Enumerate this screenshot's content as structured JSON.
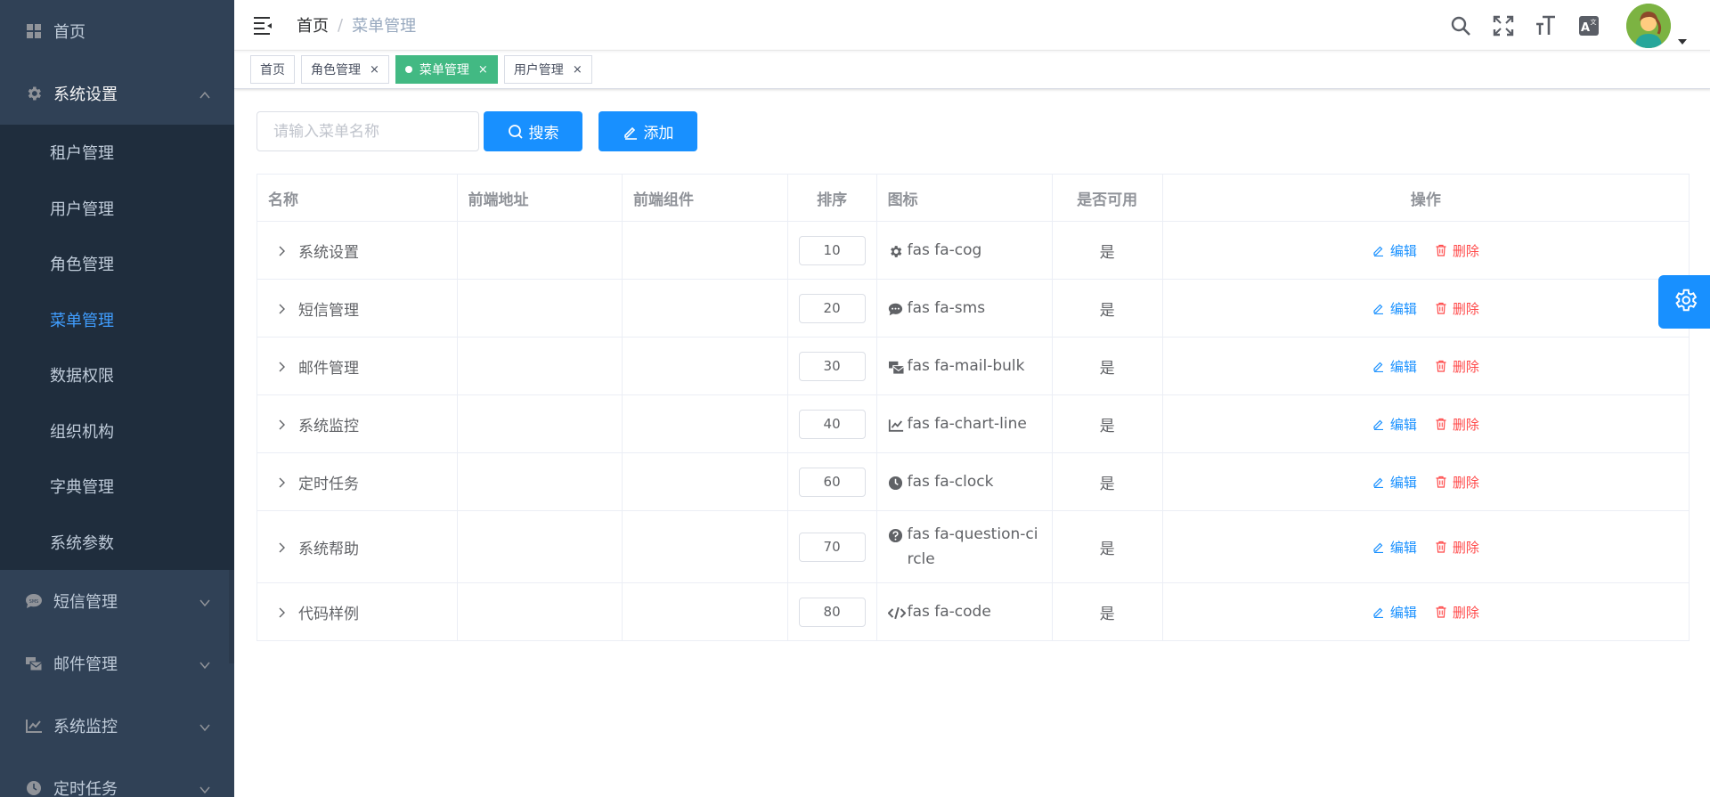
{
  "sidebar": {
    "home": "首页",
    "system": {
      "label": "系统设置",
      "children": [
        "租户管理",
        "用户管理",
        "角色管理",
        "菜单管理",
        "数据权限",
        "组织机构",
        "字典管理",
        "系统参数"
      ]
    },
    "sms": "短信管理",
    "mail": "邮件管理",
    "monitor": "系统监控",
    "timer": "定时任务"
  },
  "navbar": {
    "breadcrumb_home": "首页",
    "breadcrumb_sep": "/",
    "breadcrumb_current": "菜单管理"
  },
  "tags": {
    "home": "首页",
    "role": "角色管理",
    "menu": "菜单管理",
    "user": "用户管理",
    "close": "×"
  },
  "toolbar": {
    "search_placeholder": "请输入菜单名称",
    "search_label": "搜索",
    "add_label": "添加"
  },
  "table": {
    "headers": {
      "name": "名称",
      "path": "前端地址",
      "component": "前端组件",
      "order": "排序",
      "icon": "图标",
      "enabled": "是否可用",
      "ops": "操作"
    },
    "rows": [
      {
        "name": "系统设置",
        "order": "10",
        "icon": "fas fa-cog",
        "enabled": "是",
        "edit": "编辑",
        "del": "删除"
      },
      {
        "name": "短信管理",
        "order": "20",
        "icon": "fas fa-sms",
        "enabled": "是",
        "edit": "编辑",
        "del": "删除"
      },
      {
        "name": "邮件管理",
        "order": "30",
        "icon": "fas fa-mail-bulk",
        "enabled": "是",
        "edit": "编辑",
        "del": "删除"
      },
      {
        "name": "系统监控",
        "order": "40",
        "icon": "fas fa-chart-line",
        "enabled": "是",
        "edit": "编辑",
        "del": "删除"
      },
      {
        "name": "定时任务",
        "order": "60",
        "icon": "fas fa-clock",
        "enabled": "是",
        "edit": "编辑",
        "del": "删除"
      },
      {
        "name": "系统帮助",
        "order": "70",
        "icon": "fas fa-question-circle",
        "enabled": "是",
        "edit": "编辑",
        "del": "删除"
      },
      {
        "name": "代码样例",
        "order": "80",
        "icon": "fas fa-code",
        "enabled": "是",
        "edit": "编辑",
        "del": "删除"
      }
    ]
  },
  "colors": {
    "sidebar_bg": "#304156",
    "submenu_bg": "#1f2d3d",
    "primary": "#1890ff",
    "active_tag": "#42b983",
    "danger": "#ff4949"
  }
}
